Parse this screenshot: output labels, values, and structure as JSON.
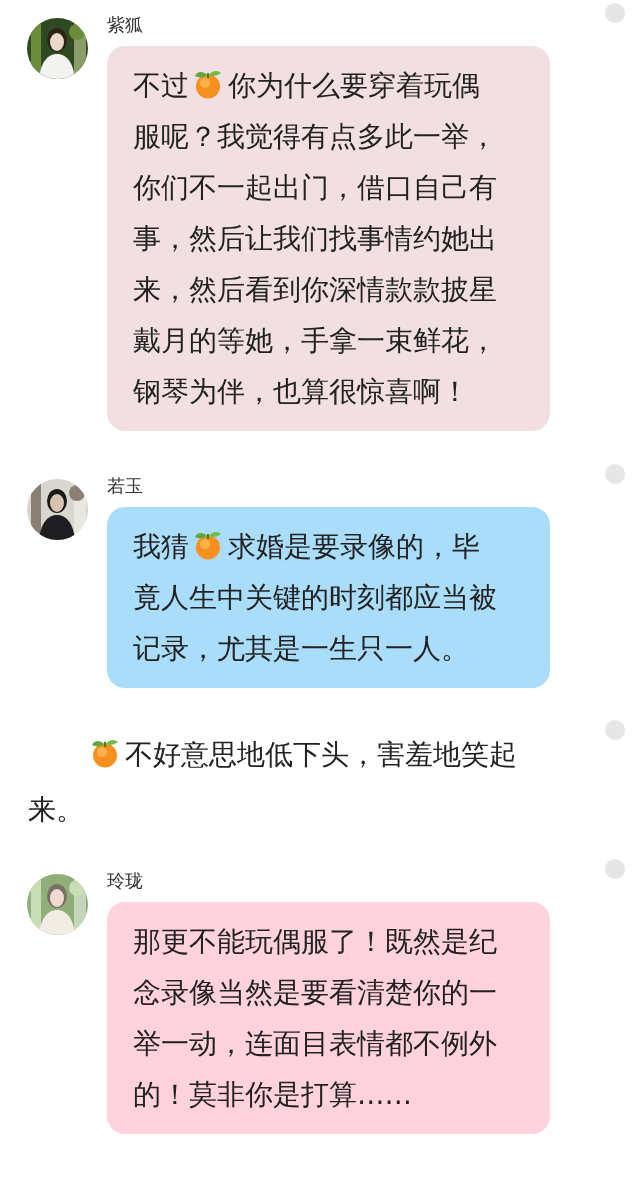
{
  "feed": [
    {
      "kind": "message",
      "name": "紫狐",
      "avatar": {
        "kind": "picture"
      },
      "color": "#f2dfe1",
      "parts": [
        {
          "kind": "text",
          "text": "不过"
        },
        {
          "kind": "icon"
        },
        {
          "kind": "text",
          "text": "你为什么要穿着玩偶服呢？我觉得有点多此一举，你们不一起出门，借口自己有事，然后让我们找事情约她出来，然后看到你深情款款披星戴月的等她，手拿一束鲜花，钢琴为伴，也算很惊喜啊！"
        }
      ]
    },
    {
      "kind": "message",
      "name": "若玉",
      "avatar": {
        "kind": "picture"
      },
      "color": "#a9ddfa",
      "parts": [
        {
          "kind": "text",
          "text": "我猜"
        },
        {
          "kind": "icon"
        },
        {
          "kind": "text",
          "text": "求婚是要录像的，毕竟人生中关键的时刻都应当被记录，尤其是一生只一人。"
        }
      ]
    },
    {
      "kind": "narration",
      "parts": [
        {
          "kind": "icon"
        },
        {
          "kind": "text",
          "text": "不好意思地低下头，害羞地笑起来。"
        }
      ]
    },
    {
      "kind": "message",
      "name": "玲珑",
      "avatar": {
        "kind": "picture"
      },
      "color": "#ffd2de",
      "parts": [
        {
          "kind": "text",
          "text": "那更不能玩偶服了！既然是纪念录像当然是要看清楚你的一举一动，连面目表情都不例外的！莫非你是打算……"
        }
      ]
    }
  ]
}
